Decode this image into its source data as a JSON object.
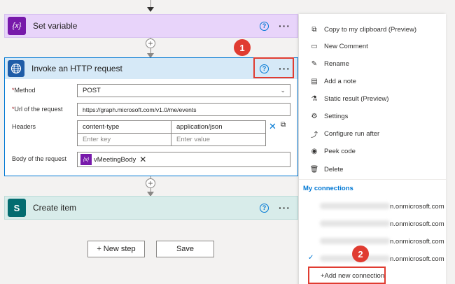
{
  "set_variable": {
    "title": "Set variable",
    "icon": "{x}"
  },
  "http": {
    "title": "Invoke an HTTP request",
    "method_label": "Method",
    "method_value": "POST",
    "url_label": "Url of the request",
    "url_value": "https://graph.microsoft.com/v1.0/me/events",
    "headers_label": "Headers",
    "header_key": "content-type",
    "header_value": "application/json",
    "key_placeholder": "Enter key",
    "value_placeholder": "Enter value",
    "body_label": "Body of the request",
    "body_token": "vMeetingBody",
    "token_icon": "{x}"
  },
  "create_item": {
    "title": "Create item",
    "icon": "S"
  },
  "buttons": {
    "new_step": "+ New step",
    "save": "Save"
  },
  "menu": {
    "items": [
      {
        "label": "Copy to my clipboard (Preview)",
        "icon": "copy-icon"
      },
      {
        "label": "New Comment",
        "icon": "comment-icon"
      },
      {
        "label": "Rename",
        "icon": "rename-icon"
      },
      {
        "label": "Add a note",
        "icon": "note-icon"
      },
      {
        "label": "Static result (Preview)",
        "icon": "beaker-icon"
      },
      {
        "label": "Settings",
        "icon": "gear-icon"
      },
      {
        "label": "Configure run after",
        "icon": "run-after-icon"
      },
      {
        "label": "Peek code",
        "icon": "eye-icon"
      },
      {
        "label": "Delete",
        "icon": "trash-icon"
      }
    ],
    "connections_heading": "My connections",
    "connections": [
      {
        "domain": "n.onmicrosoft.com",
        "selected": false
      },
      {
        "domain": "n.onmicrosoft.com",
        "selected": false
      },
      {
        "domain": "n.onmicrosoft.com",
        "selected": false
      },
      {
        "domain": "n.onmicrosoft.com",
        "selected": true
      }
    ],
    "add_connection": "+Add new connection"
  },
  "annotations": {
    "badge_1": "1",
    "badge_2": "2"
  },
  "colors": {
    "accent": "#0078d4",
    "annotation_red": "#e03c31",
    "variable_purple": "#7719aa",
    "sharepoint_teal": "#036c70"
  }
}
